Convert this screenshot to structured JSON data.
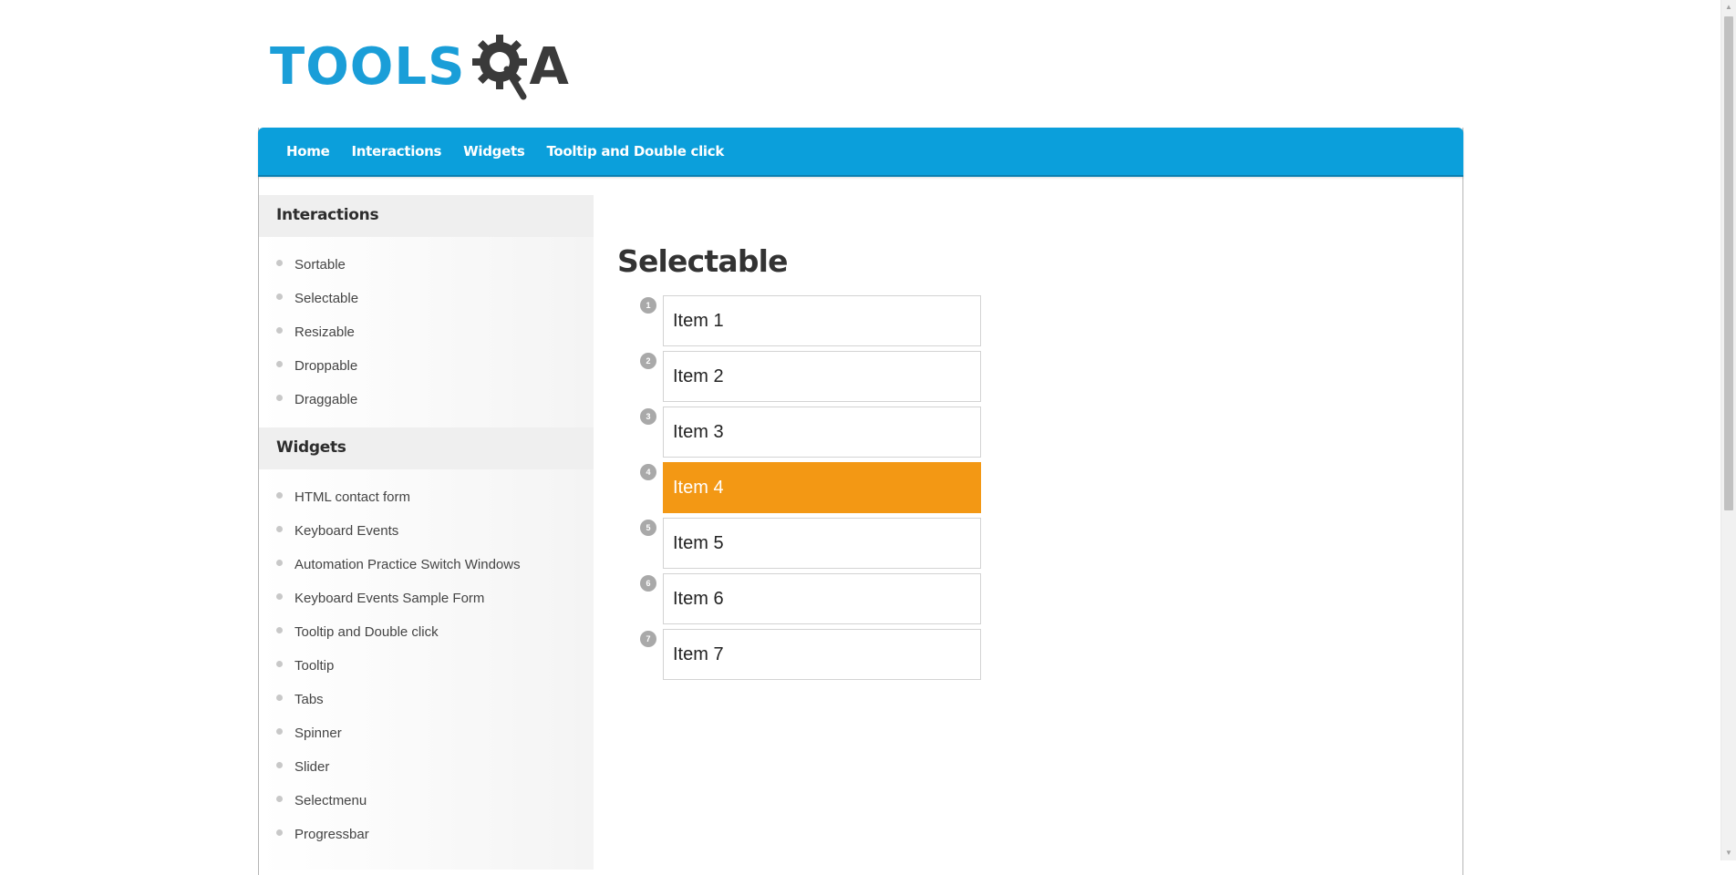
{
  "logo": {
    "text": "TOOLS",
    "suffix": "A",
    "icon": "gear-magnifier-icon"
  },
  "nav": {
    "items": [
      "Home",
      "Interactions",
      "Widgets",
      "Tooltip and Double click"
    ]
  },
  "sidebar": {
    "sections": [
      {
        "title": "Interactions",
        "items": [
          "Sortable",
          "Selectable",
          "Resizable",
          "Droppable",
          "Draggable"
        ]
      },
      {
        "title": "Widgets",
        "items": [
          "HTML contact form",
          "Keyboard Events",
          "Automation Practice Switch Windows",
          "Keyboard Events Sample Form",
          "Tooltip and Double click",
          "Tooltip",
          "Tabs",
          "Spinner",
          "Slider",
          "Selectmenu",
          "Progressbar"
        ]
      }
    ]
  },
  "main": {
    "title": "Selectable",
    "items": [
      {
        "num": "1",
        "label": "Item 1",
        "selected": false
      },
      {
        "num": "2",
        "label": "Item 2",
        "selected": false
      },
      {
        "num": "3",
        "label": "Item 3",
        "selected": false
      },
      {
        "num": "4",
        "label": "Item 4",
        "selected": true
      },
      {
        "num": "5",
        "label": "Item 5",
        "selected": false
      },
      {
        "num": "6",
        "label": "Item 6",
        "selected": false
      },
      {
        "num": "7",
        "label": "Item 7",
        "selected": false
      }
    ]
  },
  "colors": {
    "brand": "#0b9fdb",
    "selected": "#f39814",
    "logo_dark": "#3a3a3a"
  }
}
